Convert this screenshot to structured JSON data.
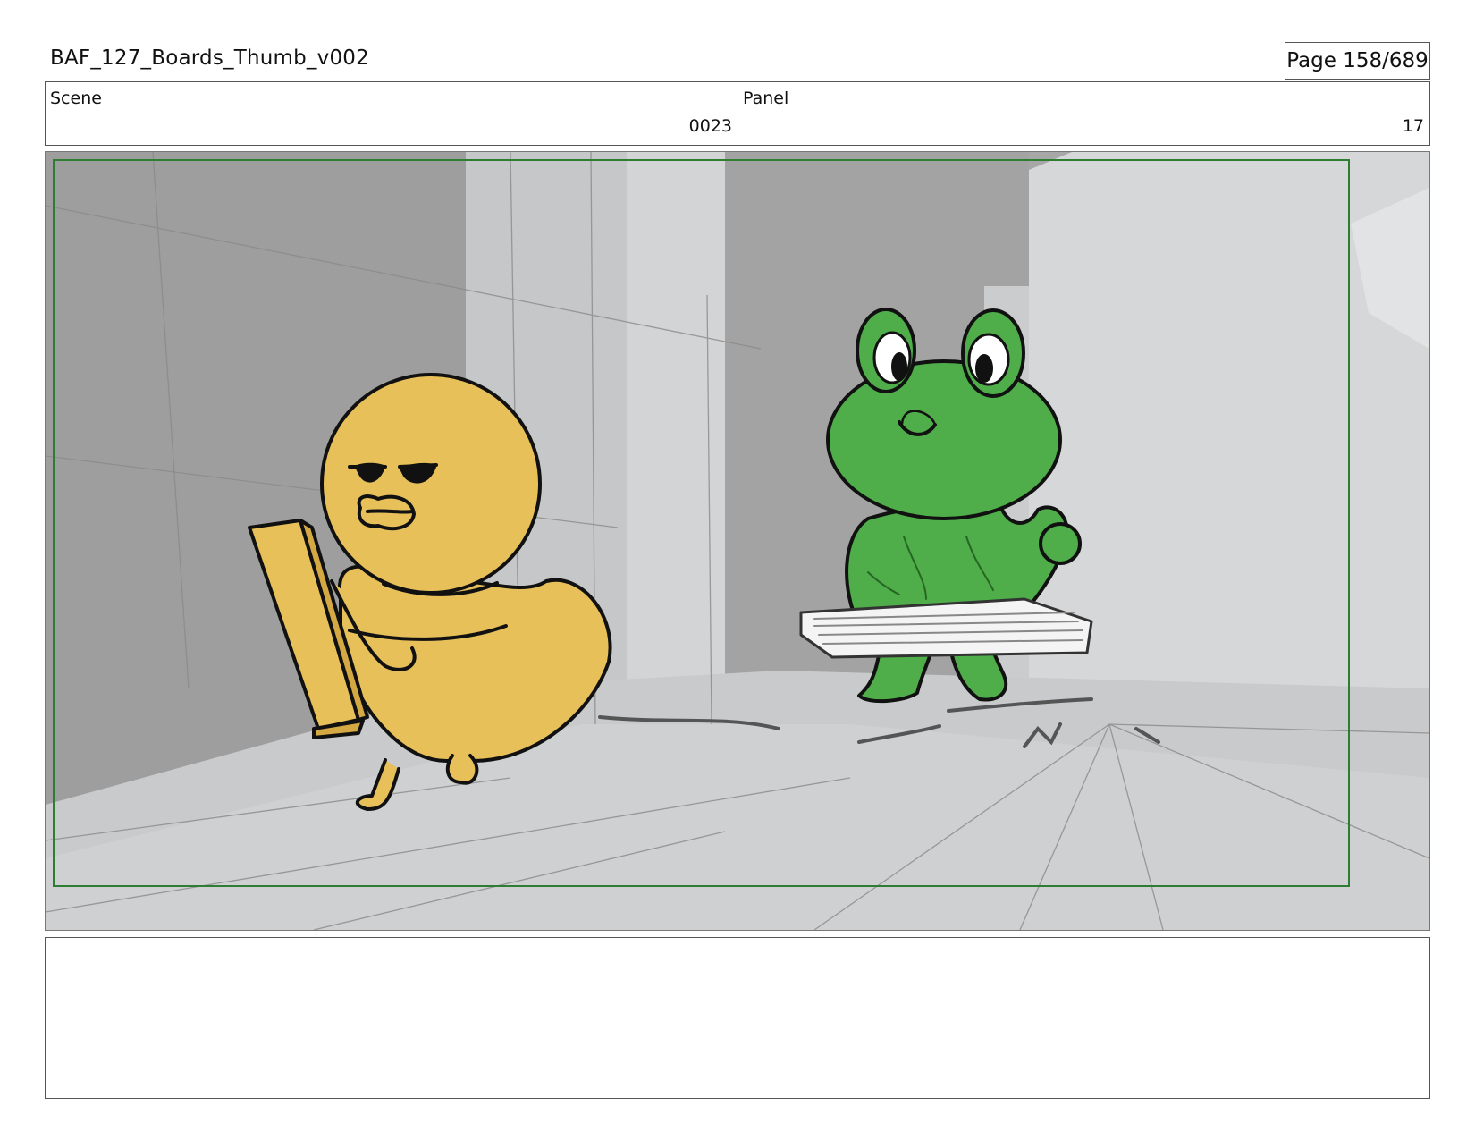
{
  "document": {
    "title": "BAF_127_Boards_Thumb_v002",
    "page_label": "Page 158/689"
  },
  "info": {
    "scene_label": "Scene",
    "scene_value": "0023",
    "panel_label": "Panel",
    "panel_value": "17"
  },
  "frame": {
    "safe_border_color": "#2e7d32",
    "characters": [
      "yellow-duck",
      "green-frog"
    ],
    "props": [
      "wooden-plank",
      "striped-board"
    ]
  },
  "notes": {
    "text": ""
  }
}
